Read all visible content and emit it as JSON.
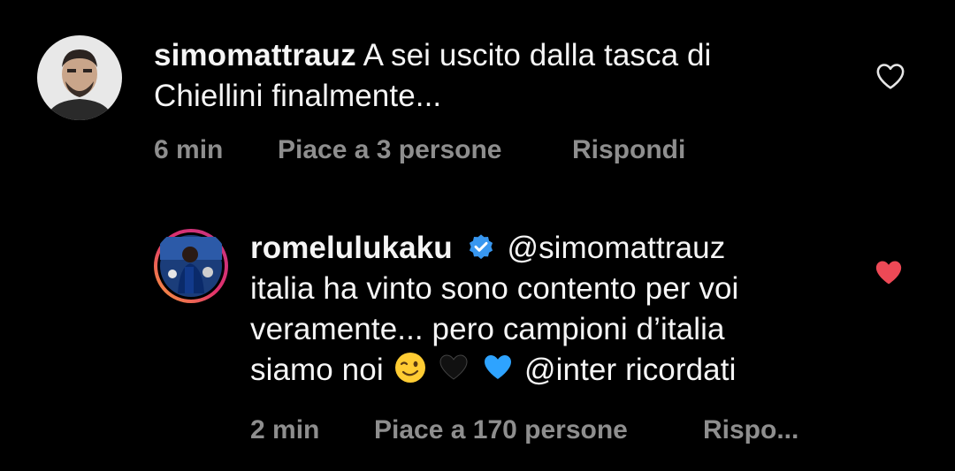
{
  "comments": [
    {
      "username": "simomattrauz",
      "text_line1": "A sei uscito dalla tasca di",
      "text_line2": "Chiellini finalmente...",
      "time": "6 min",
      "likes": "Piace a 3 persone",
      "reply": "Rispondi",
      "liked": false
    },
    {
      "username": "romelulukaku",
      "verified": true,
      "mention": "@simomattrauz",
      "text_line1": "italia ha vinto sono contento per voi",
      "text_line2": "veramente... pero campioni d’italia",
      "text_line3_start": "siamo noi",
      "text_line3_mention": "@inter",
      "text_line3_end": "ricordati",
      "emojis": [
        "winking-face-emoji",
        "black-heart-emoji",
        "blue-heart-emoji"
      ],
      "time": "2 min",
      "likes": "Piace a 170 persone",
      "reply": "Rispo...",
      "liked": true
    }
  ],
  "colors": {
    "background": "#000000",
    "text": "#f5f5f5",
    "meta": "#8e8e8e",
    "like_red": "#ed4956",
    "verified_blue": "#3897f0"
  }
}
